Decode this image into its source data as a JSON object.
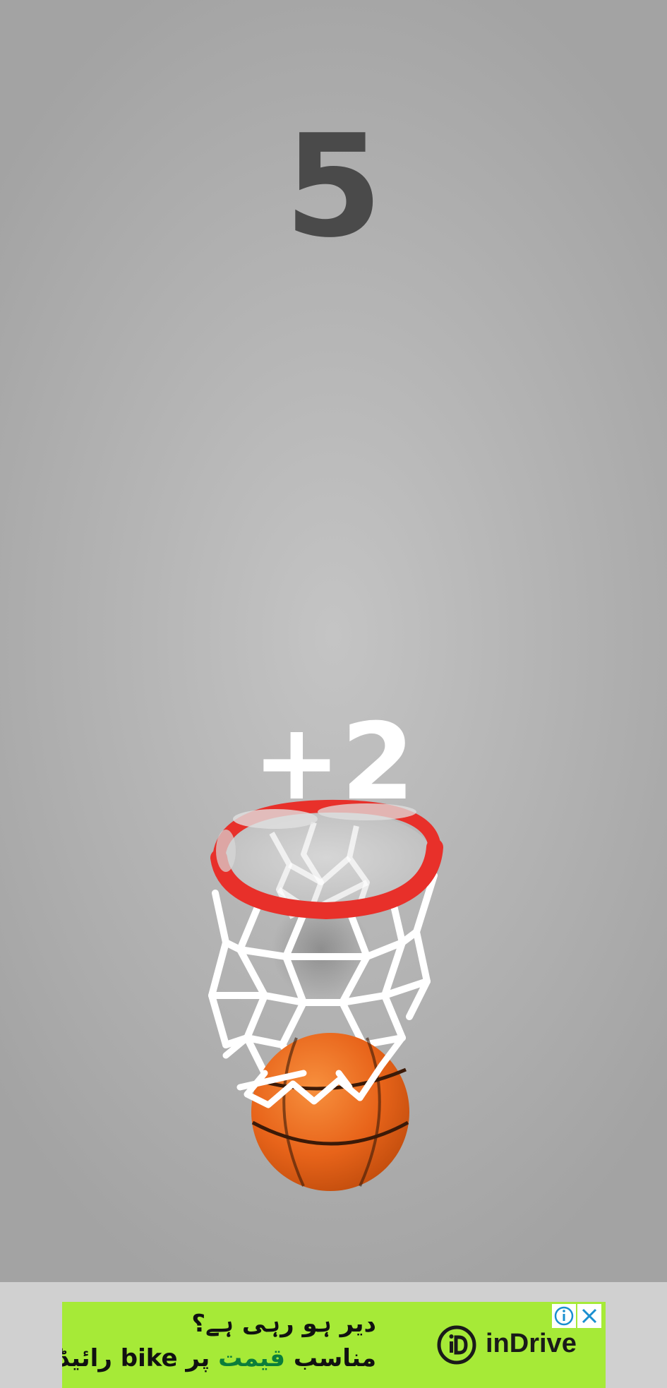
{
  "game": {
    "score": "5",
    "points_popup": "+2"
  },
  "ad": {
    "line1": "دیر ہو رہی ہے؟",
    "line2_start": "مناسب ",
    "line2_highlight": "قیمت",
    "line2_end": " پر bike رائیڈ آرڈر کریں",
    "brand": "inDrive",
    "brand_color": "#a6ea37",
    "info_icon": "info-icon",
    "close_icon": "close-icon"
  },
  "colors": {
    "rim": "#e8302a",
    "ball": "#ec6a1c",
    "score": "#4a4a4a",
    "popup": "#ffffff"
  }
}
